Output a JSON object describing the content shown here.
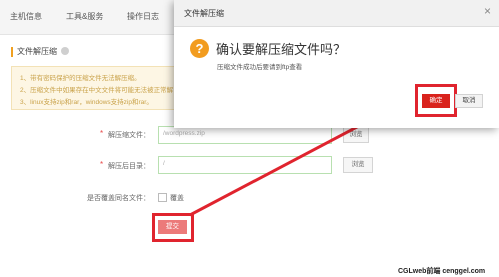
{
  "nav": {
    "tabs": [
      {
        "label": "主机信息"
      },
      {
        "label": "工具&服务"
      },
      {
        "label": "操作日志"
      }
    ]
  },
  "section": {
    "title": "文件解压缩"
  },
  "notice": {
    "lines": [
      "1、带有密码保护的压缩文件无法解压缩。",
      "2、压缩文件中如果存在中文文件将可能无法被正常解",
      "3、linux支持zip和rar，windows支持zip和rar。"
    ]
  },
  "form": {
    "archive_label": "解压缩文件：",
    "archive_value": "/wordpress.zip",
    "target_label": "解压后目录：",
    "target_value": "/",
    "overwrite_label": "是否覆盖同名文件：",
    "overwrite_option": "覆盖",
    "browse_label": "浏览",
    "submit_label": "提交",
    "required_mark": "*"
  },
  "modal": {
    "title": "文件解压缩",
    "close_glyph": "×",
    "icon_glyph": "?",
    "question": "确认要解压缩文件吗？",
    "hint": "压缩文件成功后要请到ftp查看",
    "ok_label": "确定",
    "cancel_label": "取消"
  },
  "watermark": "CGLweb前端 cenggel.com",
  "colors": {
    "highlight": "#e0242e",
    "ok": "#d9221c",
    "submit": "#ec7a7a",
    "question_icon": "#f29c1f"
  }
}
